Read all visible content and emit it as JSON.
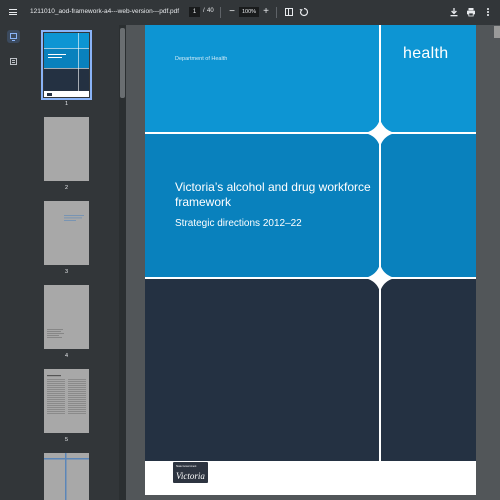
{
  "toolbar": {
    "file_name": "1211010_aod-framework-a4---web-version---pdf.pdf",
    "current_page": "1",
    "page_separator": "/",
    "total_pages": "40",
    "zoom": "100%",
    "icons": {
      "menu": "menu-icon",
      "zoom_out": "minus-icon",
      "zoom_in": "plus-icon",
      "fit": "fit-page-icon",
      "rotate": "rotate-icon",
      "download": "download-icon",
      "print": "print-icon",
      "more": "more-vert-icon"
    }
  },
  "sidebar": {
    "icons": [
      "thumbnails-icon",
      "outline-icon"
    ]
  },
  "thumbnails": [
    {
      "label": "1"
    },
    {
      "label": "2"
    },
    {
      "label": "3"
    },
    {
      "label": "4"
    },
    {
      "label": "5"
    }
  ],
  "document": {
    "department": "Department of Health",
    "brand": "health",
    "title": "Victoria’s alcohol and drug workforce framework",
    "subtitle": "Strategic directions 2012–22",
    "logo_text": "Victoria",
    "logo_small": "State Government"
  },
  "colors": {
    "toolbar_bg": "#323639",
    "viewer_bg": "#525659",
    "cover_light_blue": "#0d95d3",
    "cover_mid_blue": "#0981bd",
    "cover_navy": "#243142",
    "selection": "#8ab4f8"
  }
}
